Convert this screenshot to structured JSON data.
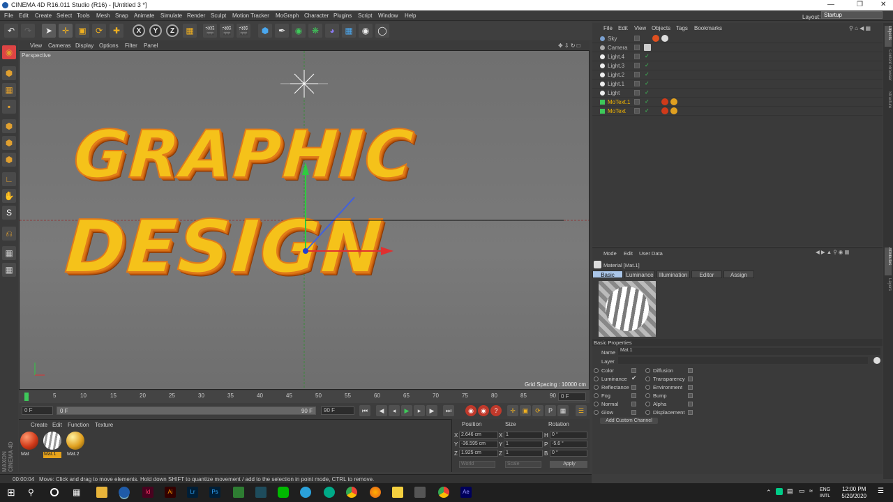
{
  "window": {
    "title": "CINEMA 4D R16.011 Studio (R16) - [Untitled 3 *]"
  },
  "menubar": [
    "File",
    "Edit",
    "Create",
    "Select",
    "Tools",
    "Mesh",
    "Snap",
    "Animate",
    "Simulate",
    "Render",
    "Sculpt",
    "Motion Tracker",
    "MoGraph",
    "Character",
    "Plugins",
    "Script",
    "Window",
    "Help"
  ],
  "layout": {
    "label": "Layout:",
    "value": "Startup"
  },
  "viewport": {
    "menu": [
      "View",
      "Cameras",
      "Display",
      "Options",
      "Filter",
      "Panel"
    ],
    "label": "Perspective",
    "grid_spacing": "Grid Spacing : 10000 cm",
    "text_line1": "GRAPHIC",
    "text_line2": "DESIGN"
  },
  "timeline": {
    "ticks": [
      "0",
      "5",
      "10",
      "15",
      "20",
      "25",
      "30",
      "35",
      "40",
      "45",
      "50",
      "55",
      "60",
      "65",
      "70",
      "75",
      "80",
      "85",
      "90"
    ],
    "current_frame_right": "0 F",
    "start_field": "0 F",
    "range_left": "0 F",
    "range_right": "90 F",
    "end_field": "90 F"
  },
  "material_manager": {
    "menu": [
      "Create",
      "Edit",
      "Function",
      "Texture"
    ],
    "materials": [
      {
        "name": "Mat",
        "color": "#d03a1a"
      },
      {
        "name": "Mat.1",
        "color": "#ffffff"
      },
      {
        "name": "Mat.2",
        "color": "#e0a020"
      }
    ]
  },
  "coordinates": {
    "headers": [
      "Position",
      "Size",
      "Rotation"
    ],
    "rows": [
      {
        "axis": "X",
        "pos": "2.646 cm",
        "saxis": "X",
        "size": "1",
        "raxis": "H",
        "rot": "0 °"
      },
      {
        "axis": "Y",
        "pos": "-36.595 cm",
        "saxis": "Y",
        "size": "1",
        "raxis": "P",
        "rot": "-5.6 °"
      },
      {
        "axis": "Z",
        "pos": "1.925 cm",
        "saxis": "Z",
        "size": "1",
        "raxis": "B",
        "rot": "0 °"
      }
    ],
    "mode1": "World",
    "mode2": "Scale",
    "apply": "Apply"
  },
  "status": {
    "time": "00:00:04",
    "message": "Move: Click and drag to move elements. Hold down SHIFT to quantize movement / add to the selection in point mode, CTRL to remove."
  },
  "object_manager": {
    "menu": [
      "File",
      "Edit",
      "View",
      "Objects",
      "Tags",
      "Bookmarks"
    ],
    "objects": [
      {
        "name": "Sky",
        "highlight": false
      },
      {
        "name": "Camera",
        "highlight": false
      },
      {
        "name": "Light.4",
        "highlight": false
      },
      {
        "name": "Light.3",
        "highlight": false
      },
      {
        "name": "Light.2",
        "highlight": false
      },
      {
        "name": "Light.1",
        "highlight": false
      },
      {
        "name": "Light",
        "highlight": false
      },
      {
        "name": "MoText.1",
        "highlight": true
      },
      {
        "name": "MoText",
        "highlight": true
      }
    ]
  },
  "attributes": {
    "menu": [
      "Mode",
      "Edit",
      "User Data"
    ],
    "title": "Material [Mat.1]",
    "tabs": [
      "Basic",
      "Luminance",
      "Illumination",
      "Editor",
      "Assign"
    ],
    "section": "Basic Properties",
    "name_label": "Name",
    "name_value": "Mat.1",
    "layer_label": "Layer",
    "channels_left": [
      {
        "label": "Color",
        "checked": false
      },
      {
        "label": "Luminance",
        "checked": true
      },
      {
        "label": "Reflectance",
        "checked": false
      },
      {
        "label": "Fog",
        "checked": false
      },
      {
        "label": "Normal",
        "checked": false
      },
      {
        "label": "Glow",
        "checked": false
      }
    ],
    "channels_right": [
      {
        "label": "Diffusion",
        "checked": false
      },
      {
        "label": "Transparency",
        "checked": false
      },
      {
        "label": "Environment",
        "checked": false
      },
      {
        "label": "Bump",
        "checked": false
      },
      {
        "label": "Alpha",
        "checked": false
      },
      {
        "label": "Displacement",
        "checked": false
      }
    ],
    "add_channel": "Add Custom Channel"
  },
  "sidestrip": [
    "Objects",
    "Content Browser",
    "Structure",
    "Attributes",
    "Layers"
  ],
  "taskbar": {
    "lang1": "ENG",
    "lang2": "INTL",
    "time": "12:00 PM",
    "date": "5/20/2020"
  }
}
